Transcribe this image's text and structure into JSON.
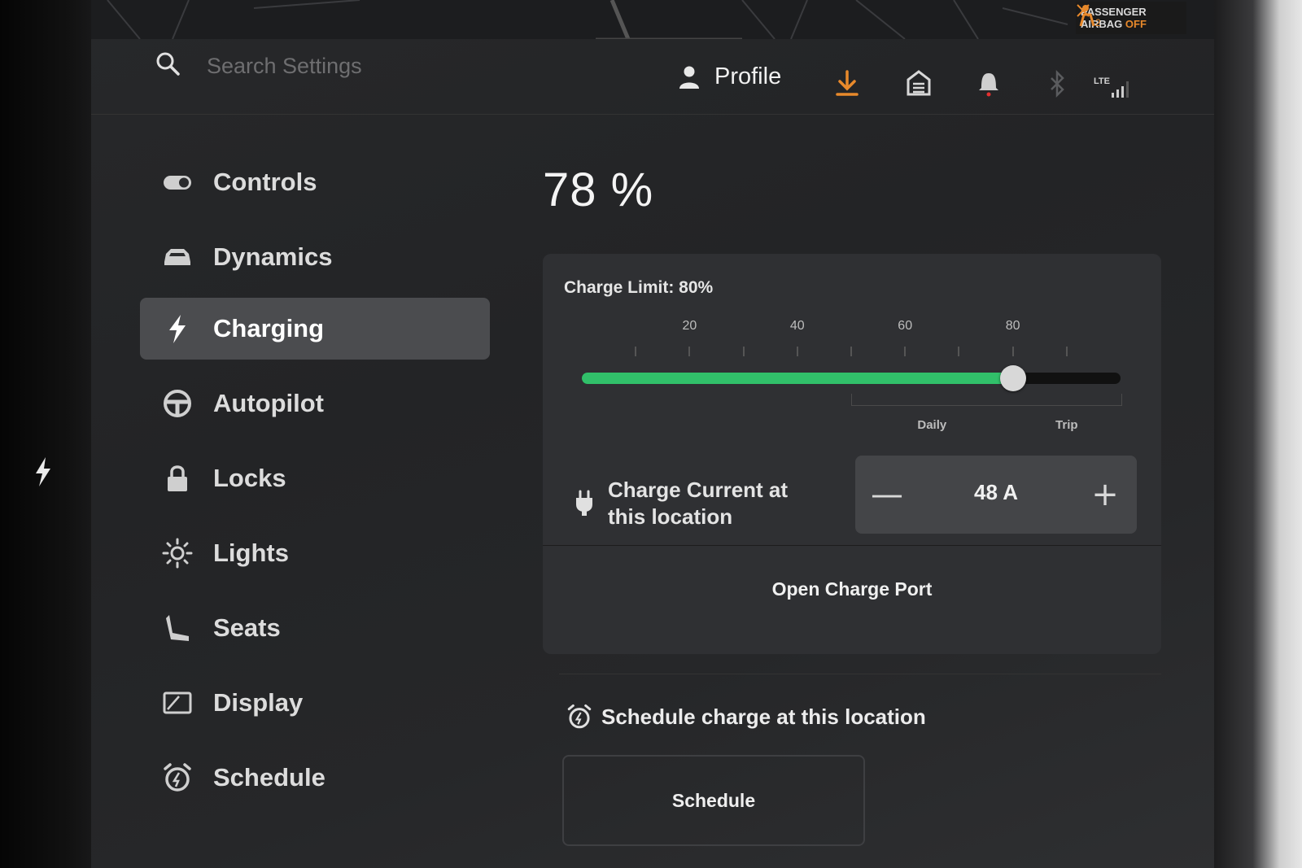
{
  "status": {
    "airbag_line1": "PASSENGER",
    "airbag_line2": "AIRBAG",
    "airbag_state": "OFF",
    "network": "LTE",
    "accent_color": "#e8892b"
  },
  "search": {
    "placeholder": "Search Settings"
  },
  "profile": {
    "label": "Profile"
  },
  "sidebar": {
    "items": [
      {
        "label": "Controls",
        "icon": "toggle-icon"
      },
      {
        "label": "Dynamics",
        "icon": "car-icon"
      },
      {
        "label": "Charging",
        "icon": "bolt-icon",
        "active": true
      },
      {
        "label": "Autopilot",
        "icon": "steering-wheel-icon"
      },
      {
        "label": "Locks",
        "icon": "lock-icon"
      },
      {
        "label": "Lights",
        "icon": "sun-icon"
      },
      {
        "label": "Seats",
        "icon": "seat-icon"
      },
      {
        "label": "Display",
        "icon": "display-icon"
      },
      {
        "label": "Schedule",
        "icon": "alarm-clock-icon"
      }
    ]
  },
  "charging": {
    "battery_percent": "78 %",
    "limit_label": "Charge Limit: 80%",
    "limit_value": 80,
    "ticks": [
      "20",
      "40",
      "60",
      "80"
    ],
    "zones": {
      "daily": "Daily",
      "trip": "Trip"
    },
    "fill_color": "#31c06a",
    "current_label": "Charge Current at this location",
    "current_value": "48 A",
    "minus_label": "—",
    "plus_label": "+",
    "open_port_label": "Open Charge Port",
    "schedule_title": "Schedule charge at this location",
    "schedule_button": "Schedule"
  }
}
